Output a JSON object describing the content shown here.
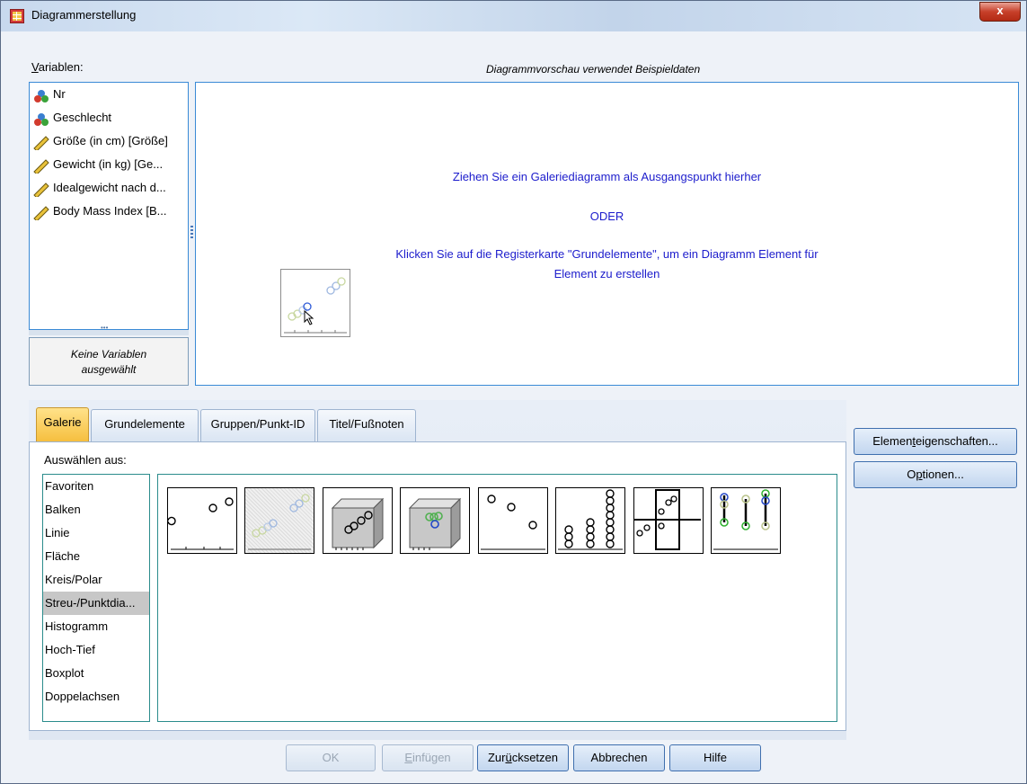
{
  "window": {
    "title": "Diagrammerstellung",
    "close_glyph": "x"
  },
  "variables": {
    "label_underlined": "V",
    "label_rest": "ariablen:",
    "items": [
      {
        "label": "Nr",
        "icon": "nominal-icon"
      },
      {
        "label": "Geschlecht",
        "icon": "nominal-icon"
      },
      {
        "label": "Größe (in cm) [Größe]",
        "icon": "scale-ruler-icon"
      },
      {
        "label": "Gewicht (in kg) [Ge...",
        "icon": "scale-ruler-icon"
      },
      {
        "label": "Idealgewicht nach d...",
        "icon": "scale-ruler-icon"
      },
      {
        "label": "Body Mass Index [B...",
        "icon": "scale-ruler-icon"
      }
    ],
    "none_selected": [
      "Keine Variablen",
      "ausgewählt"
    ]
  },
  "preview": {
    "header": "Diagrammvorschau verwendet Beispieldaten",
    "line1": "Ziehen Sie ein Galeriediagramm als Ausgangspunkt hierher",
    "line2": "ODER",
    "line3": "Klicken Sie auf die Registerkarte \"Grundelemente\", um ein Diagramm Element für",
    "line4": "Element zu erstellen"
  },
  "tabs": [
    {
      "label": "Galerie",
      "active": true
    },
    {
      "label": "Grundelemente",
      "active": false
    },
    {
      "label": "Gruppen/Punkt-ID",
      "active": false
    },
    {
      "label": "Titel/Fußnoten",
      "active": false
    }
  ],
  "gallery": {
    "choose_label": "Auswählen aus:",
    "categories": [
      "Favoriten",
      "Balken",
      "Linie",
      "Fläche",
      "Kreis/Polar",
      "Streu-/Punktdia...",
      "Histogramm",
      "Hoch-Tief",
      "Boxplot",
      "Doppelachsen"
    ],
    "selected_category": "Streu-/Punktdia...",
    "thumbnails": [
      "simple-scatter-icon",
      "grouped-scatter-icon",
      "simple-3d-scatter-icon",
      "grouped-3d-scatter-icon",
      "summary-point-plot-icon",
      "simple-dot-plot-icon",
      "scatterplot-matrix-icon",
      "drop-line-icon"
    ]
  },
  "side_buttons": {
    "element_props": {
      "pre": "Elemen",
      "ul": "t",
      "post": "eigenschaften..."
    },
    "options": {
      "pre": "O",
      "ul": "p",
      "post": "tionen..."
    }
  },
  "bottom_buttons": {
    "ok": "OK",
    "paste": {
      "ul": "E",
      "post": "infügen"
    },
    "reset": {
      "pre": "Zur",
      "ul": "ü",
      "post": "cksetzen"
    },
    "cancel": "Abbrechen",
    "help": "Hilfe"
  },
  "colors": {
    "preview_text": "#1c1ccc",
    "tab_active": "#f6bf3f",
    "panel_border": "#3a8ad6",
    "list_border": "#2b8c8c"
  }
}
